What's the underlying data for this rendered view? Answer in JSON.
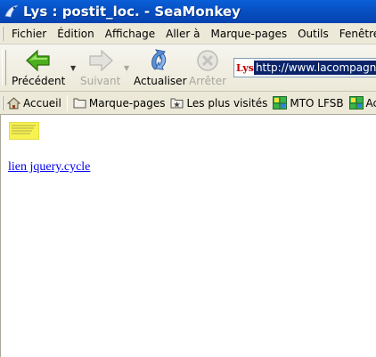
{
  "window": {
    "title": "Lys : postit_loc. - SeaMonkey",
    "icon": "seamonkey-icon"
  },
  "menubar": {
    "items": [
      "Fichier",
      "Édition",
      "Affichage",
      "Aller à",
      "Marque-pages",
      "Outils",
      "Fenêtre"
    ]
  },
  "navbar": {
    "back_label": "Précédent",
    "forward_label": "Suivant",
    "reload_label": "Actualiser",
    "stop_label": "Arrêter",
    "site_badge": "Lys",
    "url": "http://www.lacompagnie"
  },
  "bookmarks": {
    "home_label": "Accueil",
    "items": [
      "Marque-pages",
      "Les plus visités",
      "MTO LFSB",
      "Ac"
    ]
  },
  "content": {
    "link_text": "lien jquery.cycle",
    "postit_image": "postit-note-image"
  },
  "colors": {
    "titlebar": "#0851c4",
    "chrome": "#ece9d8",
    "link": "#0000ee",
    "url_selection": "#0a246a",
    "postit": "#f7f250"
  }
}
